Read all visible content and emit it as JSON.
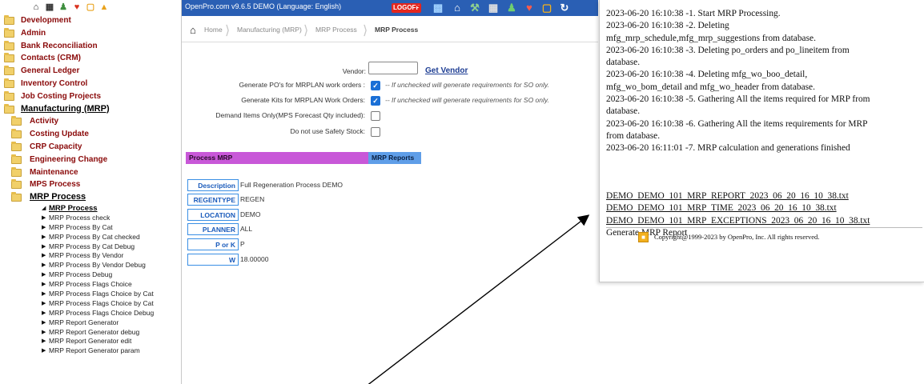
{
  "sidebar": {
    "top_icons": [
      "home-icon",
      "calculator-icon",
      "users-icon",
      "heart-icon",
      "box-icon",
      "warning-icon"
    ],
    "modules": [
      {
        "label": "Development"
      },
      {
        "label": "Admin"
      },
      {
        "label": "Bank Reconciliation"
      },
      {
        "label": "Contacts (CRM)"
      },
      {
        "label": "General Ledger"
      },
      {
        "label": "Inventory Control"
      },
      {
        "label": "Job Costing Projects"
      },
      {
        "label": "Manufacturing (MRP)"
      }
    ],
    "manufacturing_items": [
      {
        "label": "Activity"
      },
      {
        "label": "Costing Update"
      },
      {
        "label": "CRP Capacity"
      },
      {
        "label": "Engineering Change"
      },
      {
        "label": "Maintenance"
      },
      {
        "label": "MPS Process"
      },
      {
        "label": "MRP Process"
      }
    ],
    "mrp_items": [
      "MRP Process",
      "MRP Process check",
      "MRP Process By Cat",
      "MRP Process By Cat checked",
      "MRP Process By Cat Debug",
      "MRP Process By Vendor",
      "MRP Process By Vendor Debug",
      "MRP Process Debug",
      "MRP Process Flags Choice",
      "MRP Process Flags Choice by Cat",
      "MRP Process Flags Choice by Cat",
      "MRP Process Flags Choice Debug",
      "MRP Report Generator",
      "MRP Report Generator debug",
      "MRP Report Generator edit",
      "MRP Report Generator param"
    ]
  },
  "topbar": {
    "title": "OpenPro.com v9.6.5  DEMO  (Language: English)",
    "logoff": "LOGOFF"
  },
  "breadcrumb": {
    "home": "Home",
    "manufacturing": "Manufacturing (MRP)",
    "process": "MRP Process",
    "current": "MRP Process"
  },
  "form": {
    "vendor_label": "Vendor:",
    "vendor_value": "",
    "get_vendor": "Get Vendor",
    "gen_pos_label": "Generate PO's for MRPLAN work orders :",
    "gen_pos_note": "-- If unchecked will generate requirements for SO only.",
    "gen_kits_label": "Generate Kits for MRPLAN Work Orders:",
    "gen_kits_note": "-- If unchecked will generate requirements for SO only.",
    "demand_label": "Demand Items Only(MPS Forecast Qty included):",
    "safety_label": "Do not use Safety Stock:",
    "gen_pos_checked": true,
    "gen_kits_checked": true,
    "demand_checked": false,
    "safety_checked": false
  },
  "sections": {
    "process_mrp": "Process MRP",
    "mrp_reports": "MRP Reports"
  },
  "params": [
    {
      "name": "Description",
      "value": "Full Regeneration Process DEMO"
    },
    {
      "name": "REGENTYPE",
      "value": "REGEN"
    },
    {
      "name": "LOCATION",
      "value": "DEMO"
    },
    {
      "name": "PLANNER",
      "value": "ALL"
    },
    {
      "name": "P or K",
      "value": "P"
    },
    {
      "name": "W",
      "value": "18.00000"
    }
  ],
  "log": [
    "2023-06-20 16:10:38 -1. Start MRP Processing.",
    "2023-06-20 16:10:38 -2. Deleting",
    "mfg_mrp_schedule,mfg_mrp_suggestions from database.",
    "2023-06-20 16:10:38 -3. Deleting po_orders and po_lineitem from",
    "database.",
    "2023-06-20 16:10:38 -4. Deleting mfg_wo_boo_detail,",
    "mfg_wo_bom_detail and mfg_wo_header from database.",
    "2023-06-20 16:10:38 -5. Gathering All the items required for MRP from",
    "database.",
    "2023-06-20 16:10:38 -6. Gathering All the items requirements for MRP",
    "from database.",
    "2023-06-20 16:11:01 -7. MRP calculation and generations finished"
  ],
  "report_links": [
    "DEMO_DEMO_101_MRP_REPORT_2023_06_20_16_10_38.txt",
    "DEMO_DEMO_101_MRP_TIME_2023_06_20_16_10_38.txt",
    "DEMO_DEMO_101_MRP_EXCEPTIONS_2023_06_20_16_10_38.txt"
  ],
  "generate_report": "Generate MRP Report",
  "copyright": "Copyright@1999-2023 by OpenPro, Inc. All rights reserved.",
  "colors": {
    "menu_red": "#8a0a0a",
    "topbar_blue": "#2a5fb4",
    "process_bar": "#c858d8",
    "reports_bar": "#5f9ee8",
    "param_border": "#3a8fe4",
    "checkbox_blue": "#1a6fd6"
  }
}
